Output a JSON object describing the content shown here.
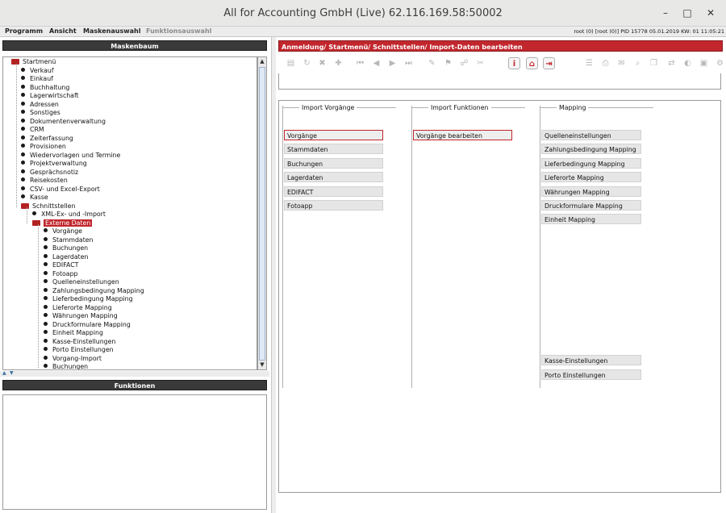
{
  "window": {
    "title": "All for Accounting GmbH (Live) 62.116.169.58:50002"
  },
  "menu": {
    "items": [
      "Programm",
      "Ansicht",
      "Maskenauswahl",
      "Funktionsauswahl"
    ],
    "status": "root (0) [root (0)] PID 15778   05.01.2019   KW:  01   11:05:21"
  },
  "left": {
    "tree_title": "Maskenbaum",
    "functions_title": "Funktionen",
    "tree": [
      {
        "label": "Startmenü",
        "level": 0,
        "type": "folder"
      },
      {
        "label": "Verkauf",
        "level": 1,
        "type": "leaf"
      },
      {
        "label": "Einkauf",
        "level": 1,
        "type": "leaf"
      },
      {
        "label": "Buchhaltung",
        "level": 1,
        "type": "leaf"
      },
      {
        "label": "Lagerwirtschaft",
        "level": 1,
        "type": "leaf"
      },
      {
        "label": "Adressen",
        "level": 1,
        "type": "leaf"
      },
      {
        "label": "Sonstiges",
        "level": 1,
        "type": "leaf"
      },
      {
        "label": "Dokumentenverwaltung",
        "level": 1,
        "type": "leaf"
      },
      {
        "label": "CRM",
        "level": 1,
        "type": "leaf"
      },
      {
        "label": "Zeiterfassung",
        "level": 1,
        "type": "leaf"
      },
      {
        "label": "Provisionen",
        "level": 1,
        "type": "leaf"
      },
      {
        "label": "Wiedervorlagen und Termine",
        "level": 1,
        "type": "leaf"
      },
      {
        "label": "Projektverwaltung",
        "level": 1,
        "type": "leaf"
      },
      {
        "label": "Gesprächsnotiz",
        "level": 1,
        "type": "leaf"
      },
      {
        "label": "Reisekosten",
        "level": 1,
        "type": "leaf"
      },
      {
        "label": "CSV- und Excel-Export",
        "level": 1,
        "type": "leaf"
      },
      {
        "label": "Kasse",
        "level": 1,
        "type": "leaf"
      },
      {
        "label": "Schnittstellen",
        "level": 1,
        "type": "folder"
      },
      {
        "label": "XML-Ex- und -Import",
        "level": 2,
        "type": "leaf"
      },
      {
        "label": "Externe Daten",
        "level": 2,
        "type": "folder",
        "selected": true
      },
      {
        "label": "Vorgänge",
        "level": 3,
        "type": "leaf"
      },
      {
        "label": "Stammdaten",
        "level": 3,
        "type": "leaf"
      },
      {
        "label": "Buchungen",
        "level": 3,
        "type": "leaf"
      },
      {
        "label": "Lagerdaten",
        "level": 3,
        "type": "leaf"
      },
      {
        "label": "EDIFACT",
        "level": 3,
        "type": "leaf"
      },
      {
        "label": "Fotoapp",
        "level": 3,
        "type": "leaf"
      },
      {
        "label": "Quelleneinstellungen",
        "level": 3,
        "type": "leaf"
      },
      {
        "label": "Zahlungsbedingung Mapping",
        "level": 3,
        "type": "leaf"
      },
      {
        "label": "Lieferbedingung Mapping",
        "level": 3,
        "type": "leaf"
      },
      {
        "label": "Lieferorte Mapping",
        "level": 3,
        "type": "leaf"
      },
      {
        "label": "Währungen Mapping",
        "level": 3,
        "type": "leaf"
      },
      {
        "label": "Druckformulare Mapping",
        "level": 3,
        "type": "leaf"
      },
      {
        "label": "Einheit Mapping",
        "level": 3,
        "type": "leaf"
      },
      {
        "label": "Kasse-Einstellungen",
        "level": 3,
        "type": "leaf"
      },
      {
        "label": "Porto Einstellungen",
        "level": 3,
        "type": "leaf"
      },
      {
        "label": "Vorgang-Import",
        "level": 3,
        "type": "leaf"
      },
      {
        "label": "Buchungen",
        "level": 3,
        "type": "leaf"
      }
    ]
  },
  "main": {
    "breadcrumb": "Anmeldung/ Startmenü/ Schnittstellen/ Import-Daten bearbeiten",
    "toolbar_icons": [
      "new-icon",
      "refresh-icon",
      "delete-icon",
      "add-icon",
      "first-icon",
      "prev-icon",
      "next-icon",
      "last-icon",
      "edit-icon",
      "filter-icon",
      "link-icon",
      "unlink-icon",
      "info-icon",
      "home-icon",
      "export-icon",
      "doc-icon",
      "print-icon",
      "mail-icon",
      "search-icon",
      "copy-icon",
      "swap-icon",
      "color-icon",
      "image-icon",
      "settings-icon"
    ],
    "groups": [
      {
        "title": "Import Vorgänge",
        "buttons": [
          "Vorgänge",
          "Stammdaten",
          "Buchungen",
          "Lagerdaten",
          "EDIFACT",
          "Fotoapp"
        ]
      },
      {
        "title": "Import Funktionen",
        "buttons": [
          "Vorgänge bearbeiten"
        ]
      },
      {
        "title": "Mapping",
        "buttons": [
          "Quelleneinstellungen",
          "Zahlungsbedingung Mapping",
          "Lieferbedingung Mapping",
          "Lieferorte Mapping",
          "Währungen Mapping",
          "Druckformulare Mapping",
          "Einheit Mapping"
        ],
        "bottom_buttons": [
          "Kasse-Einstellungen",
          "Porto Einstellungen"
        ]
      }
    ],
    "colors": {
      "accent": "#c1272d",
      "panel_header": "#3a3a3a"
    }
  }
}
